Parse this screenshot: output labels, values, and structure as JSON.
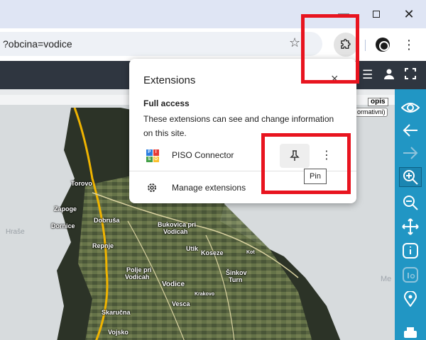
{
  "browser": {
    "url": "?obcina=vodice",
    "window_controls": {
      "minimize": "—",
      "close": "✕"
    }
  },
  "extensions_popup": {
    "title": "Extensions",
    "section_title": "Full access",
    "section_description": "These extensions can see and change information on this site.",
    "extensions": [
      {
        "name": "PISO Connector",
        "icon": "piso-logo"
      }
    ],
    "manage_label": "Manage extensions",
    "pin_tooltip": "Pin"
  },
  "map": {
    "labels": [
      {
        "text": "Torovo"
      },
      {
        "text": "Zapoge"
      },
      {
        "text": "Dornice"
      },
      {
        "text": "Dobruša"
      },
      {
        "text": "Bukovica pri"
      },
      {
        "text": "Vodicah"
      },
      {
        "text": "Repnje"
      },
      {
        "text": "Utik"
      },
      {
        "text": "Koseze"
      },
      {
        "text": "Kot"
      },
      {
        "text": "Polje pri"
      },
      {
        "text": "Vodicah"
      },
      {
        "text": "Šinkov"
      },
      {
        "text": "Turn"
      },
      {
        "text": "Vodice"
      },
      {
        "text": "Krakovo"
      },
      {
        "text": "Vesca"
      },
      {
        "text": "Skaručna"
      },
      {
        "text": "Vojsko"
      },
      {
        "text": "Hraše"
      },
      {
        "text": "Me"
      }
    ],
    "opis_label": "opis",
    "informativni_label": "ormativni)"
  },
  "colors": {
    "accent_sidebar": "#2196c4",
    "annotation_red": "#e8141f",
    "appbar": "#2f3640"
  }
}
